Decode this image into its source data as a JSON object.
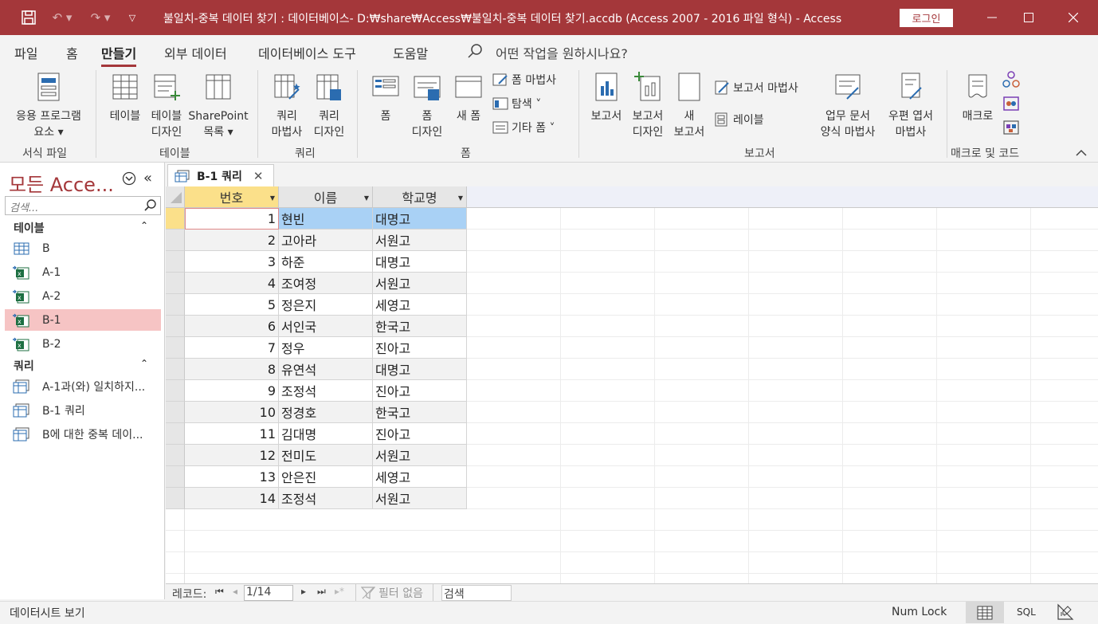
{
  "titlebar": {
    "title": "불일치-중복 데이터 찾기 : 데이터베이스- D:₩share₩Access₩불일치-중복 데이터 찾기.accdb (Access 2007 - 2016 파일 형식)  -  Access",
    "login": "로그인",
    "accent_color": "#a4373a"
  },
  "menu": {
    "items": [
      "파일",
      "홈",
      "만들기",
      "외부 데이터",
      "데이터베이스 도구",
      "도움말"
    ],
    "active": "만들기",
    "tellme": "어떤 작업을 원하시나요?"
  },
  "ribbon": {
    "app_parts": [
      "응용 프로그램",
      "요소"
    ],
    "table": "테이블",
    "table_design": [
      "테이블",
      "디자인"
    ],
    "sharepoint": [
      "SharePoint",
      "목록"
    ],
    "query_wizard": [
      "쿼리",
      "마법사"
    ],
    "query_design": [
      "쿼리",
      "디자인"
    ],
    "form": "폼",
    "form_design": [
      "폼",
      "디자인"
    ],
    "blank_form": "새 폼",
    "form_wizard": "폼 마법사",
    "navigation": "탐색",
    "more_forms": "기타 폼",
    "report": "보고서",
    "report_design": [
      "보고서",
      "디자인"
    ],
    "blank_report": [
      "새",
      "보고서"
    ],
    "report_wizard": "보고서 마법사",
    "labels": "레이블",
    "biz_form_wizard": [
      "업무 문서",
      "양식 마법사"
    ],
    "postal_wizard": [
      "우편 엽서",
      "마법사"
    ],
    "macro": "매크로",
    "groups": [
      "서식 파일",
      "테이블",
      "쿼리",
      "폼",
      "보고서",
      "매크로 및 코드"
    ]
  },
  "nav": {
    "title": "모든 Acce...",
    "search_placeholder": "검색...",
    "tables_header": "테이블",
    "queries_header": "쿼리",
    "tables": [
      "B",
      "A-1",
      "A-2",
      "B-1",
      "B-2"
    ],
    "selected": "B-1",
    "queries": [
      "A-1과(와) 일치하지...",
      "B-1 쿼리",
      "B에 대한 중복 데이..."
    ]
  },
  "tab": {
    "label": "B-1 쿼리"
  },
  "datasheet": {
    "columns": [
      "번호",
      "이름",
      "학교명"
    ],
    "rows": [
      [
        "1",
        "현빈",
        "대명고"
      ],
      [
        "2",
        "고아라",
        "서원고"
      ],
      [
        "3",
        "하준",
        "대명고"
      ],
      [
        "4",
        "조여정",
        "서원고"
      ],
      [
        "5",
        "정은지",
        "세영고"
      ],
      [
        "6",
        "서인국",
        "한국고"
      ],
      [
        "7",
        "정우",
        "진아고"
      ],
      [
        "8",
        "유연석",
        "대명고"
      ],
      [
        "9",
        "조정석",
        "진아고"
      ],
      [
        "10",
        "정경호",
        "한국고"
      ],
      [
        "11",
        "김대명",
        "진아고"
      ],
      [
        "12",
        "전미도",
        "서원고"
      ],
      [
        "13",
        "안은진",
        "세영고"
      ],
      [
        "14",
        "조정석",
        "서원고"
      ]
    ]
  },
  "recordbar": {
    "label": "레코드:",
    "position": "1/14",
    "filter": "필터 없음",
    "search": "검색"
  },
  "status": {
    "view": "데이터시트 보기",
    "numlock": "Num Lock",
    "sql": "SQL"
  }
}
